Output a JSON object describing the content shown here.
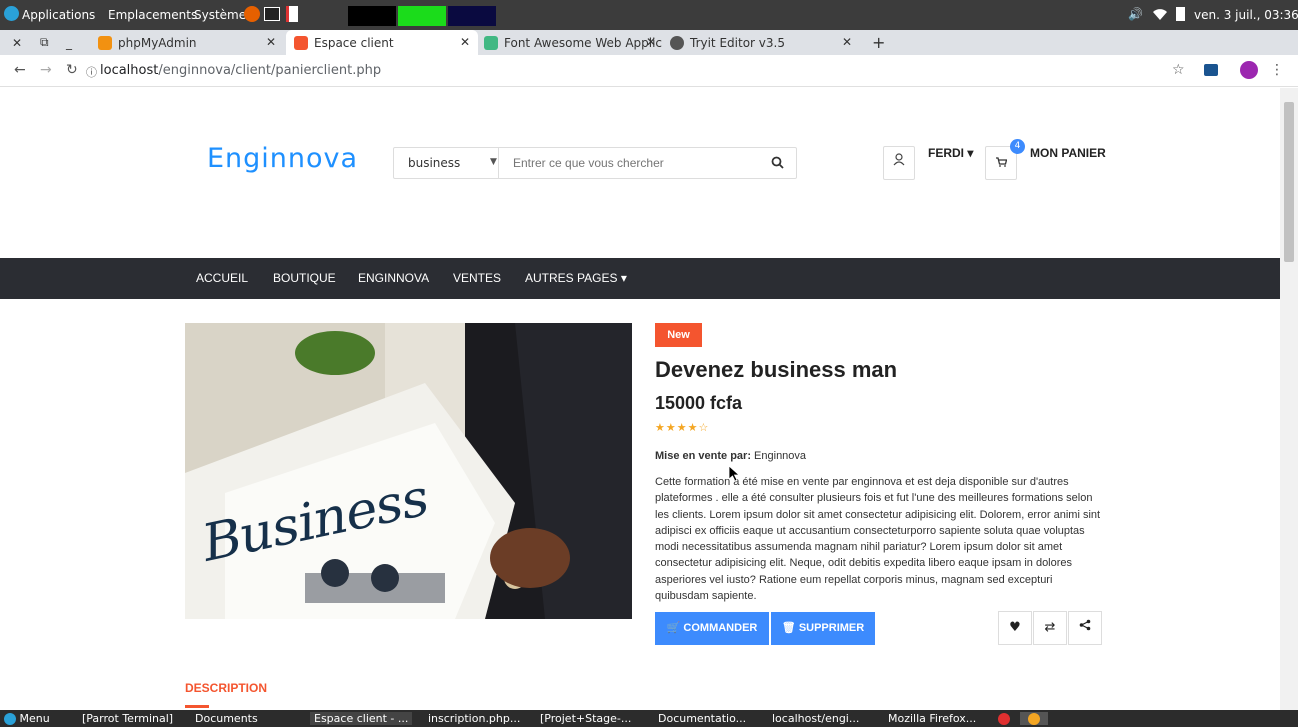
{
  "os_bar": {
    "applications": "Applications",
    "places": "Emplacements",
    "system": "Système",
    "clock": "ven. 3 juil., 03:36"
  },
  "browser": {
    "tabs": [
      {
        "label": "phpMyAdmin"
      },
      {
        "label": "Espace client"
      },
      {
        "label": "Font Awesome Web Applic"
      },
      {
        "label": "Tryit Editor v3.5"
      }
    ],
    "new_tab": "+",
    "url_host": "localhost",
    "url_path": "/enginnova/client/panierclient.php"
  },
  "header": {
    "logo": "Enginnova",
    "search_category": "business",
    "search_placeholder": "Entrer ce que vous chercher",
    "user_name": "FERDI",
    "cart_count": "4",
    "cart_label": "MON PANIER"
  },
  "nav": {
    "items": [
      "ACCUEIL",
      "BOUTIQUE",
      "ENGINNOVA",
      "VENTES",
      "AUTRES PAGES"
    ]
  },
  "hero_image": {
    "headline": "Business"
  },
  "product": {
    "badge": "New",
    "title": "Devenez business man",
    "price": "15000 fcfa",
    "rating": 4,
    "rating_max": 5,
    "seller_label": "Mise en vente par:",
    "seller": "Enginnova",
    "description": "Cette formation a été mise en vente par enginnova et est deja disponible sur d'autres plateformes . elle a été consulter plusieurs fois et fut l'une des meilleures formations selon les clients. Lorem ipsum dolor sit amet consectetur adipisicing elit. Dolorem, error animi sint adipisci ex officiis eaque ut accusantium consecteturporro sapiente soluta quae voluptas modi necessitatibus assumenda magnam nihil pariatur? Lorem ipsum dolor sit amet consectetur adipisicing elit. Neque, odit debitis expedita libero eaque ipsam in dolores asperiores vel iusto? Ratione eum repellat corporis minus, magnam sed excepturi quibusdam sapiente.",
    "order_label": "COMMANDER",
    "delete_label": "SUPPRIMER"
  },
  "tabs_section": {
    "description_label": "DESCRIPTION"
  },
  "taskbar": {
    "menu": "Menu",
    "items": [
      "[Parrot Terminal]",
      "Documents",
      "Espace client - ...",
      "inscription.php...",
      "[Projet+Stage-...",
      "Documentatio...",
      "localhost/engi...",
      "Mozilla Firefox..."
    ]
  },
  "colors": {
    "accent": "#3d8bfd",
    "badge_new": "#f4552f",
    "nav_bg": "#2b2d33",
    "star": "#f4a623"
  }
}
